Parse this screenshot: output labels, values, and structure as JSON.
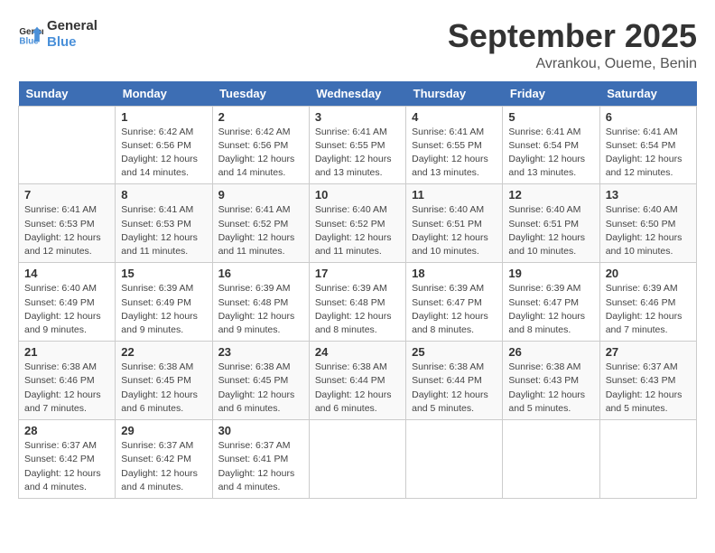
{
  "logo": {
    "general": "General",
    "blue": "Blue"
  },
  "title": "September 2025",
  "location": "Avrankou, Oueme, Benin",
  "weekdays": [
    "Sunday",
    "Monday",
    "Tuesday",
    "Wednesday",
    "Thursday",
    "Friday",
    "Saturday"
  ],
  "weeks": [
    [
      {
        "day": "",
        "info": ""
      },
      {
        "day": "1",
        "info": "Sunrise: 6:42 AM\nSunset: 6:56 PM\nDaylight: 12 hours\nand 14 minutes."
      },
      {
        "day": "2",
        "info": "Sunrise: 6:42 AM\nSunset: 6:56 PM\nDaylight: 12 hours\nand 14 minutes."
      },
      {
        "day": "3",
        "info": "Sunrise: 6:41 AM\nSunset: 6:55 PM\nDaylight: 12 hours\nand 13 minutes."
      },
      {
        "day": "4",
        "info": "Sunrise: 6:41 AM\nSunset: 6:55 PM\nDaylight: 12 hours\nand 13 minutes."
      },
      {
        "day": "5",
        "info": "Sunrise: 6:41 AM\nSunset: 6:54 PM\nDaylight: 12 hours\nand 13 minutes."
      },
      {
        "day": "6",
        "info": "Sunrise: 6:41 AM\nSunset: 6:54 PM\nDaylight: 12 hours\nand 12 minutes."
      }
    ],
    [
      {
        "day": "7",
        "info": "Sunrise: 6:41 AM\nSunset: 6:53 PM\nDaylight: 12 hours\nand 12 minutes."
      },
      {
        "day": "8",
        "info": "Sunrise: 6:41 AM\nSunset: 6:53 PM\nDaylight: 12 hours\nand 11 minutes."
      },
      {
        "day": "9",
        "info": "Sunrise: 6:41 AM\nSunset: 6:52 PM\nDaylight: 12 hours\nand 11 minutes."
      },
      {
        "day": "10",
        "info": "Sunrise: 6:40 AM\nSunset: 6:52 PM\nDaylight: 12 hours\nand 11 minutes."
      },
      {
        "day": "11",
        "info": "Sunrise: 6:40 AM\nSunset: 6:51 PM\nDaylight: 12 hours\nand 10 minutes."
      },
      {
        "day": "12",
        "info": "Sunrise: 6:40 AM\nSunset: 6:51 PM\nDaylight: 12 hours\nand 10 minutes."
      },
      {
        "day": "13",
        "info": "Sunrise: 6:40 AM\nSunset: 6:50 PM\nDaylight: 12 hours\nand 10 minutes."
      }
    ],
    [
      {
        "day": "14",
        "info": "Sunrise: 6:40 AM\nSunset: 6:49 PM\nDaylight: 12 hours\nand 9 minutes."
      },
      {
        "day": "15",
        "info": "Sunrise: 6:39 AM\nSunset: 6:49 PM\nDaylight: 12 hours\nand 9 minutes."
      },
      {
        "day": "16",
        "info": "Sunrise: 6:39 AM\nSunset: 6:48 PM\nDaylight: 12 hours\nand 9 minutes."
      },
      {
        "day": "17",
        "info": "Sunrise: 6:39 AM\nSunset: 6:48 PM\nDaylight: 12 hours\nand 8 minutes."
      },
      {
        "day": "18",
        "info": "Sunrise: 6:39 AM\nSunset: 6:47 PM\nDaylight: 12 hours\nand 8 minutes."
      },
      {
        "day": "19",
        "info": "Sunrise: 6:39 AM\nSunset: 6:47 PM\nDaylight: 12 hours\nand 8 minutes."
      },
      {
        "day": "20",
        "info": "Sunrise: 6:39 AM\nSunset: 6:46 PM\nDaylight: 12 hours\nand 7 minutes."
      }
    ],
    [
      {
        "day": "21",
        "info": "Sunrise: 6:38 AM\nSunset: 6:46 PM\nDaylight: 12 hours\nand 7 minutes."
      },
      {
        "day": "22",
        "info": "Sunrise: 6:38 AM\nSunset: 6:45 PM\nDaylight: 12 hours\nand 6 minutes."
      },
      {
        "day": "23",
        "info": "Sunrise: 6:38 AM\nSunset: 6:45 PM\nDaylight: 12 hours\nand 6 minutes."
      },
      {
        "day": "24",
        "info": "Sunrise: 6:38 AM\nSunset: 6:44 PM\nDaylight: 12 hours\nand 6 minutes."
      },
      {
        "day": "25",
        "info": "Sunrise: 6:38 AM\nSunset: 6:44 PM\nDaylight: 12 hours\nand 5 minutes."
      },
      {
        "day": "26",
        "info": "Sunrise: 6:38 AM\nSunset: 6:43 PM\nDaylight: 12 hours\nand 5 minutes."
      },
      {
        "day": "27",
        "info": "Sunrise: 6:37 AM\nSunset: 6:43 PM\nDaylight: 12 hours\nand 5 minutes."
      }
    ],
    [
      {
        "day": "28",
        "info": "Sunrise: 6:37 AM\nSunset: 6:42 PM\nDaylight: 12 hours\nand 4 minutes."
      },
      {
        "day": "29",
        "info": "Sunrise: 6:37 AM\nSunset: 6:42 PM\nDaylight: 12 hours\nand 4 minutes."
      },
      {
        "day": "30",
        "info": "Sunrise: 6:37 AM\nSunset: 6:41 PM\nDaylight: 12 hours\nand 4 minutes."
      },
      {
        "day": "",
        "info": ""
      },
      {
        "day": "",
        "info": ""
      },
      {
        "day": "",
        "info": ""
      },
      {
        "day": "",
        "info": ""
      }
    ]
  ]
}
